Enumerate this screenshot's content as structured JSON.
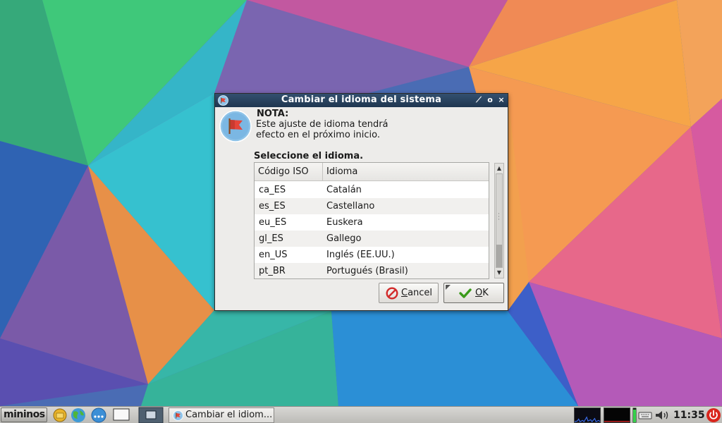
{
  "dialog": {
    "title": "Cambiar el idioma del sistema",
    "note_title": "NOTA:",
    "note_line1": "Este ajuste de idioma tendrá",
    "note_line2": "efecto en el próximo inicio.",
    "select_label": "Seleccione el idioma.",
    "columns": [
      "Código ISO",
      "Idioma"
    ],
    "rows": [
      {
        "code": "ca_ES",
        "language": "Catalán"
      },
      {
        "code": "es_ES",
        "language": "Castellano"
      },
      {
        "code": "eu_ES",
        "language": "Euskera"
      },
      {
        "code": "gl_ES",
        "language": "Gallego"
      },
      {
        "code": "en_US",
        "language": "Inglés (EE.UU.)"
      },
      {
        "code": "pt_BR",
        "language": "Portugués (Brasil)"
      }
    ],
    "cancel_label_first": "C",
    "cancel_label_rest": "ancel",
    "ok_label_first": "O",
    "ok_label_rest": "K",
    "titlebar_buttons": [
      "pin-icon",
      "maximize-icon",
      "close-icon"
    ]
  },
  "taskbar": {
    "menu_label": "mininos",
    "task_label": "Cambiar el idiom...",
    "clock": "11:35",
    "icons": [
      "folder-icon",
      "globe-icon",
      "more-icon",
      "show-desktop-icon",
      "window-switcher-icon",
      "keyboard-icon",
      "volume-icon",
      "power-icon"
    ]
  },
  "colors": {
    "titlebar": "#1f3650",
    "dialog_bg": "#edecea",
    "ok_check": "#3a9a1a",
    "cancel_red": "#d22a2a",
    "flag": "#e5453a"
  }
}
